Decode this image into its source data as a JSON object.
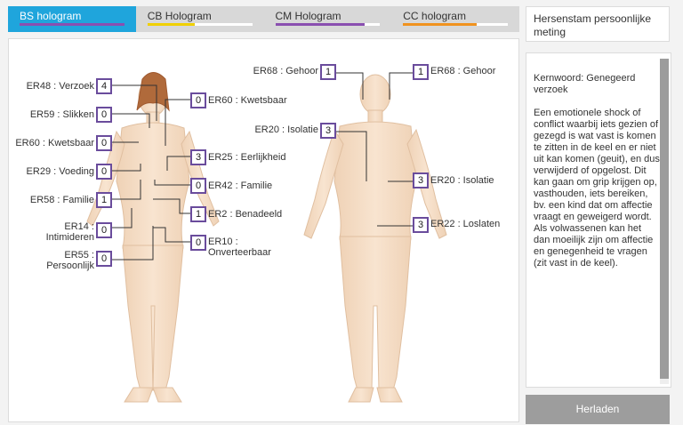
{
  "tabs": [
    {
      "label": "BS hologram",
      "color": "#8a4fb0",
      "progress": 1.0,
      "active": true
    },
    {
      "label": "CB Hologram",
      "color": "#f0d000",
      "progress": 0.45,
      "active": false
    },
    {
      "label": "CM Hologram",
      "color": "#8a4fb0",
      "progress": 0.85,
      "active": false
    },
    {
      "label": "CC hologram",
      "color": "#f0921e",
      "progress": 0.7,
      "active": false
    }
  ],
  "front": [
    {
      "code": "ER48 : Verzoek",
      "value": "4"
    },
    {
      "code": "ER59 : Slikken",
      "value": "0"
    },
    {
      "code": "ER60 : Kwetsbaar",
      "value": "0"
    },
    {
      "code": "ER29 : Voeding",
      "value": "0"
    },
    {
      "code": "ER58 : Familie",
      "value": "1"
    },
    {
      "code": "ER14 :\nIntimideren",
      "value": "0"
    },
    {
      "code": "ER55 :\nPersoonlijk",
      "value": "0"
    },
    {
      "code": "ER60 : Kwetsbaar",
      "value": "0"
    },
    {
      "code": "ER25 : Eerlijkheid",
      "value": "3"
    },
    {
      "code": "ER42 : Familie",
      "value": "0"
    },
    {
      "code": "ER2 : Benadeeld",
      "value": "1"
    },
    {
      "code": "ER10 :\nOnverteerbaar",
      "value": "0"
    }
  ],
  "back": [
    {
      "code": "ER68 : Gehoor",
      "value": "1"
    },
    {
      "code": "ER20 : Isolatie",
      "value": "3"
    },
    {
      "code": "ER68 : Gehoor",
      "value": "1"
    },
    {
      "code": "ER20 : Isolatie",
      "value": "3"
    },
    {
      "code": "ER22 : Loslaten",
      "value": "3"
    }
  ],
  "panel": {
    "title": "Hersenstam persoonlijke meting",
    "keyword": "Kernwoord: Genegeerd verzoek",
    "body": "Een emotionele shock of conflict waarbij iets gezien of gezegd is wat vast is komen te zitten in de keel en er niet uit kan komen (geuit), en dus verwijderd of opgelost. Dit kan gaan om grip krijgen op, vasthouden, iets bereiken, bv. een kind dat om affectie vraagt en geweigerd wordt. Als volwassenen kan het dan moeilijk zijn om affectie en genegenheid te vragen (zit vast in de keel)."
  },
  "reload_label": "Herladen"
}
